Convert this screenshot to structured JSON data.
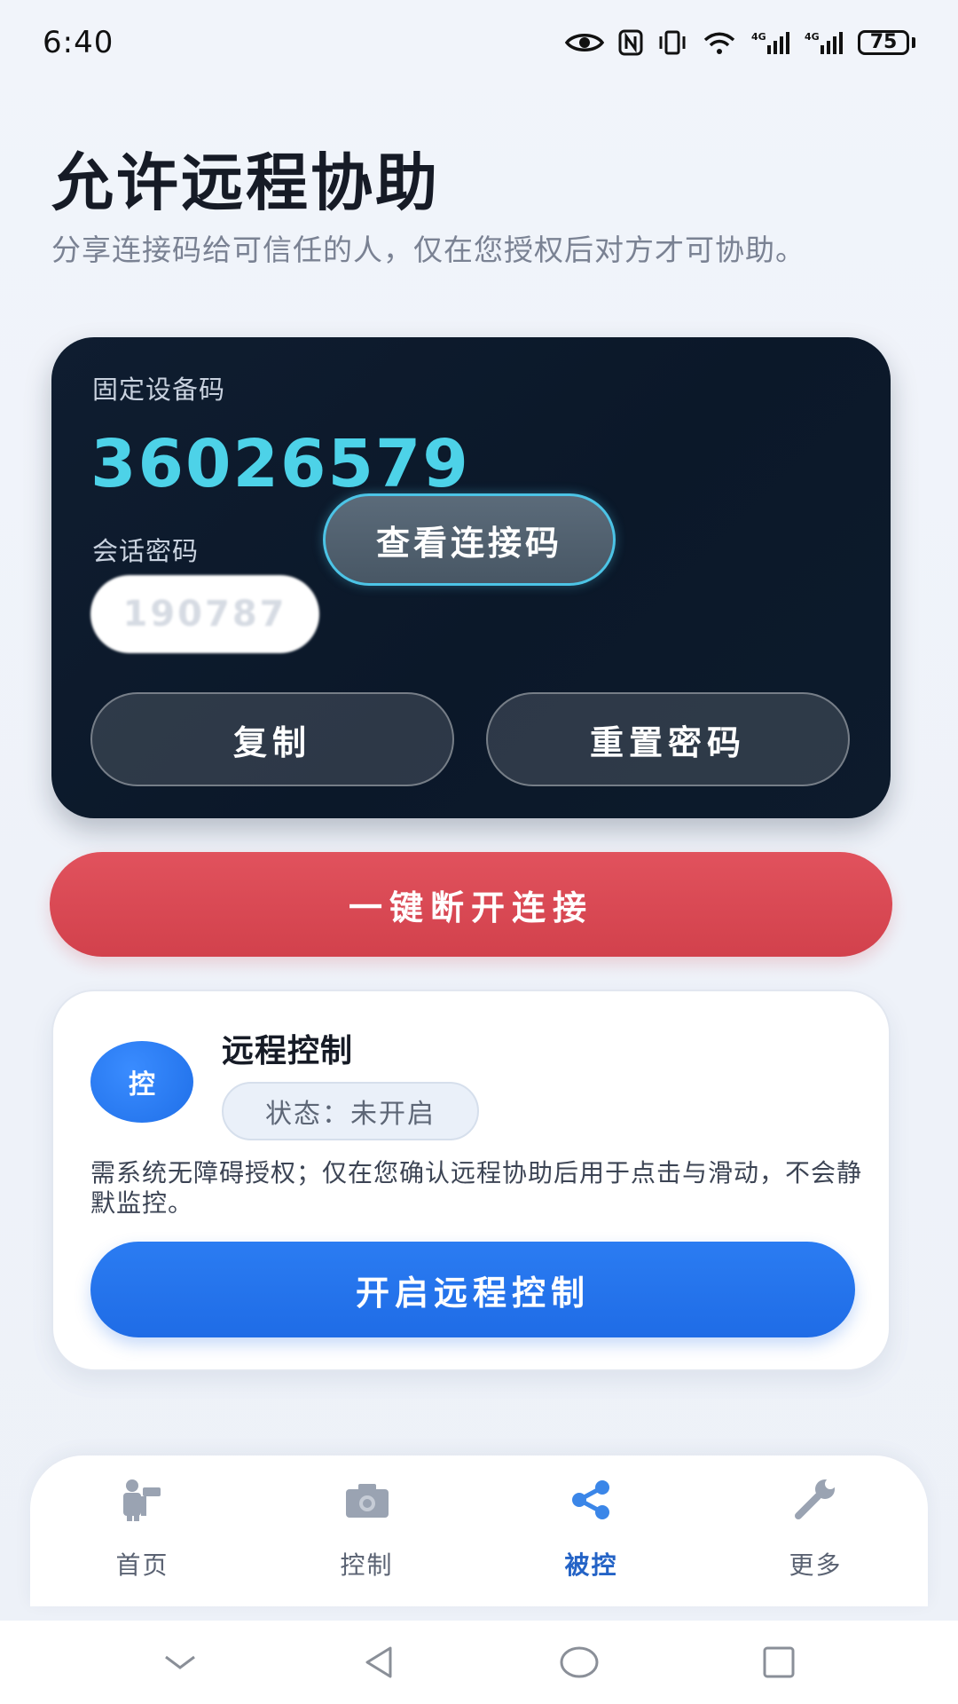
{
  "status_bar": {
    "time": "6:40",
    "battery": "75",
    "icons": [
      "eye-icon",
      "nfc-icon",
      "vibrate-icon",
      "wifi-icon",
      "signal-4g-icon",
      "signal-4g-icon"
    ]
  },
  "header": {
    "title": "允许远程协助",
    "subtitle": "分享连接码给可信任的人，仅在您授权后对方才可协助。"
  },
  "device_card": {
    "device_code_label": "固定设备码",
    "device_code": "36026579",
    "session_password_label": "会话密码",
    "session_password": "190787",
    "reveal_button": "查看连接码",
    "copy_button": "复制",
    "reset_button": "重置密码"
  },
  "disconnect_button": "一键断开连接",
  "remote_control": {
    "avatar_text": "控",
    "title": "远程控制",
    "status": "状态：未开启",
    "description": "需系统无障碍授权；仅在您确认远程协助后用于点击与滑动，不会静默监控。",
    "enable_button": "开启远程控制"
  },
  "bottom_nav": {
    "items": [
      {
        "label": "首页",
        "icon": "home-icon",
        "active": false
      },
      {
        "label": "控制",
        "icon": "camera-icon",
        "active": false
      },
      {
        "label": "被控",
        "icon": "share-icon",
        "active": true
      },
      {
        "label": "更多",
        "icon": "wrench-icon",
        "active": false
      }
    ]
  },
  "colors": {
    "accent_blue": "#1f6ce6",
    "danger_red": "#d2414c",
    "device_code_cyan": "#4dd2e8",
    "card_dark": "#0b1829",
    "nav_active": "#2463c6"
  }
}
